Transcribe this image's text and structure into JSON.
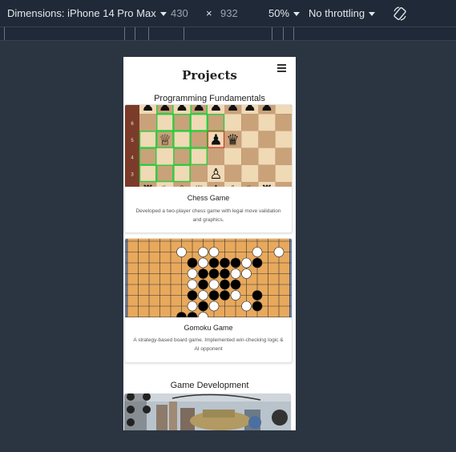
{
  "devtools": {
    "dimensions_label": "Dimensions: iPhone 14 Pro Max",
    "width_value": "430",
    "times": "×",
    "height_value": "932",
    "zoom": "50%",
    "throttling": "No throttling",
    "rotate_icon": "rotate-icon"
  },
  "page": {
    "title": "Projects",
    "menu_icon": "hamburger-icon"
  },
  "sections": [
    {
      "title": "Programming Fundamentals",
      "cards": [
        {
          "title": "Chess Game",
          "description": "Developed a two-player chess game with legal move validation and graphics."
        },
        {
          "title": "Gomoku Game",
          "description": "A strategy-based board game. Implemented win-checking logic & AI opponent"
        }
      ]
    },
    {
      "title": "Game Development"
    }
  ],
  "chess_board": {
    "rank_labels": [
      "6",
      "5",
      "4",
      "3"
    ]
  },
  "colors": {
    "devtools_bg": "#1f2937",
    "page_bg": "#2b3441",
    "highlight_green": "#2ecc40",
    "gomoku_board": "#e8a95c"
  }
}
